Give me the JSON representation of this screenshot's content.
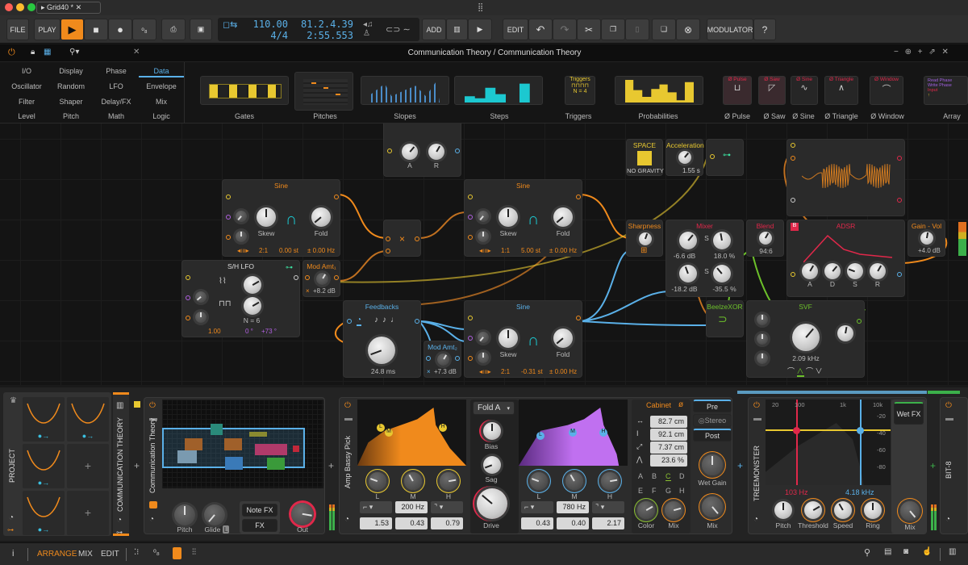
{
  "window": {
    "tab_title": "Grid40 *",
    "colors": {
      "accent": "#f08a1c",
      "blue": "#5ab0e8",
      "red": "#e0284a",
      "green": "#6cc02a",
      "yellow": "#e8c830",
      "purple": "#b060e0"
    }
  },
  "toolbar": {
    "file": "FILE",
    "play": "PLAY",
    "add": "ADD",
    "edit": "EDIT",
    "modulator": "MODULATOR",
    "tempo": "110.00",
    "time_signature": "4/4",
    "position_beats": "81.2.4.39",
    "position_time": "2:55.553"
  },
  "grid_header": {
    "title": "Communication Theory / Communication Theory"
  },
  "palette": {
    "categories": [
      [
        "I/O",
        "Display",
        "Phase",
        "Data"
      ],
      [
        "Oscillator",
        "Random",
        "LFO",
        "Envelope"
      ],
      [
        "Filter",
        "Shaper",
        "Delay/FX",
        "Mix"
      ],
      [
        "Level",
        "Pitch",
        "Math",
        "Logic"
      ]
    ],
    "selected_category": "Data",
    "presets": [
      "Gates",
      "Pitches",
      "Slopes",
      "Steps",
      "Triggers",
      "Probabilities",
      "Ø Pulse",
      "Ø Saw",
      "Ø Sine",
      "Ø Triangle",
      "Ø Window",
      "Array"
    ],
    "thumb_text": {
      "triggers_title": "Triggers",
      "triggers_n": "N = 4",
      "pulse": "Ø Pulse",
      "saw": "Ø Saw",
      "sine": "Ø Sine",
      "triangle": "Ø Triangle",
      "window": "Ø Window",
      "array_items": [
        "Read Phase",
        "Write Phase",
        "Input",
        "↑"
      ]
    }
  },
  "modules": {
    "env_ar": {
      "a": "A",
      "r": "R"
    },
    "sine1": {
      "title": "Sine",
      "skew": "Skew",
      "fold": "Fold",
      "ratio": "2:1",
      "semitones": "0.00 st",
      "hz": "± 0.00 Hz"
    },
    "sine2": {
      "title": "Sine",
      "skew": "Skew",
      "fold": "Fold",
      "ratio": "1:1",
      "semitones": "5.00 st",
      "hz": "± 0.00 Hz"
    },
    "sine3": {
      "title": "Sine",
      "skew": "Skew",
      "fold": "Fold",
      "ratio": "2:1",
      "semitones": "-0.31 st",
      "hz": "± 0.00 Hz"
    },
    "sh_lfo": {
      "title": "S/H LFO",
      "n": "N = 6",
      "rate": "1.00",
      "phase": "0 °",
      "spread": "+73 °"
    },
    "mod_amt1": {
      "title": "Mod Amt₁",
      "value": "+8.2 dB"
    },
    "mod_amt2": {
      "title": "Mod Amt₂",
      "value": "+7.3 dB"
    },
    "feedbacks": {
      "title": "Feedbacks",
      "time": "24.8 ms"
    },
    "space": {
      "title": "SPACE",
      "mode": "NO GRAVITY"
    },
    "acceleration": {
      "title": "Acceleration",
      "value": "1.55 s"
    },
    "sharpness": {
      "title": "Sharpness"
    },
    "mixer": {
      "title": "Mixer",
      "s": "S",
      "gain1": "-6.6 dB",
      "pct1": "18.0 %",
      "gain2": "-18.2 dB",
      "pct2": "-35.5 %"
    },
    "blend": {
      "title": "Blend",
      "value": "94:6"
    },
    "adsr": {
      "title": "ADSR",
      "badge": "B",
      "a": "A",
      "d": "D",
      "s": "S",
      "r": "R"
    },
    "gain_vol": {
      "title": "Gain - Vol",
      "value": "+4.0 dB"
    },
    "xor": {
      "title": "BeelzeXOR"
    },
    "svf": {
      "title": "SVF",
      "cutoff": "2.09 kHz"
    }
  },
  "bottom": {
    "project": {
      "label": "PROJECT"
    },
    "track": {
      "label": "COMMUNICATION THEORY"
    },
    "grid_device": {
      "name": "Communication Theory",
      "pitch": "Pitch",
      "glide": "Glide",
      "glide_badge": "L",
      "note_fx": "Note FX",
      "fx": "FX",
      "out": "Out"
    },
    "amp": {
      "name": "Amp Bassy Pick",
      "l": "L",
      "m": "M",
      "h": "H",
      "freq1": "200 Hz",
      "v1": [
        "1.53",
        "0.43",
        "0.79"
      ],
      "mode": "Fold A",
      "bias": "Bias",
      "sag": "Sag",
      "drive": "Drive",
      "freq2": "780 Hz",
      "v2": [
        "0.43",
        "0.40",
        "2.17"
      ],
      "cabinet": "Cabinet",
      "cab_values": [
        "82.7 cm",
        "92.1 cm",
        "7.37 cm",
        "23.6 %"
      ],
      "mic_letters": [
        "A",
        "B",
        "C",
        "D",
        "E",
        "F",
        "G",
        "H"
      ],
      "selected_mic": "C",
      "color": "Color",
      "mix": "Mix",
      "pre": "Pre",
      "stereo": "Stereo",
      "post": "Post",
      "wet_gain": "Wet Gain",
      "mix2": "Mix"
    },
    "treemonster": {
      "name": "TREEMONSTER",
      "freq_ticks": [
        "20",
        "100",
        "1k",
        "10k"
      ],
      "db_ticks": [
        "-20",
        "-40",
        "-60",
        "-80"
      ],
      "low": "103 Hz",
      "high": "4.18 kHz",
      "pitch": "Pitch",
      "threshold": "Threshold",
      "speed": "Speed",
      "ring": "Ring",
      "wet_fx": "Wet FX",
      "mix": "Mix"
    },
    "bit8": {
      "name": "BIT-8"
    }
  },
  "status": {
    "info": "i",
    "arrange": "ARRANGE",
    "mix": "MIX",
    "edit": "EDIT"
  }
}
